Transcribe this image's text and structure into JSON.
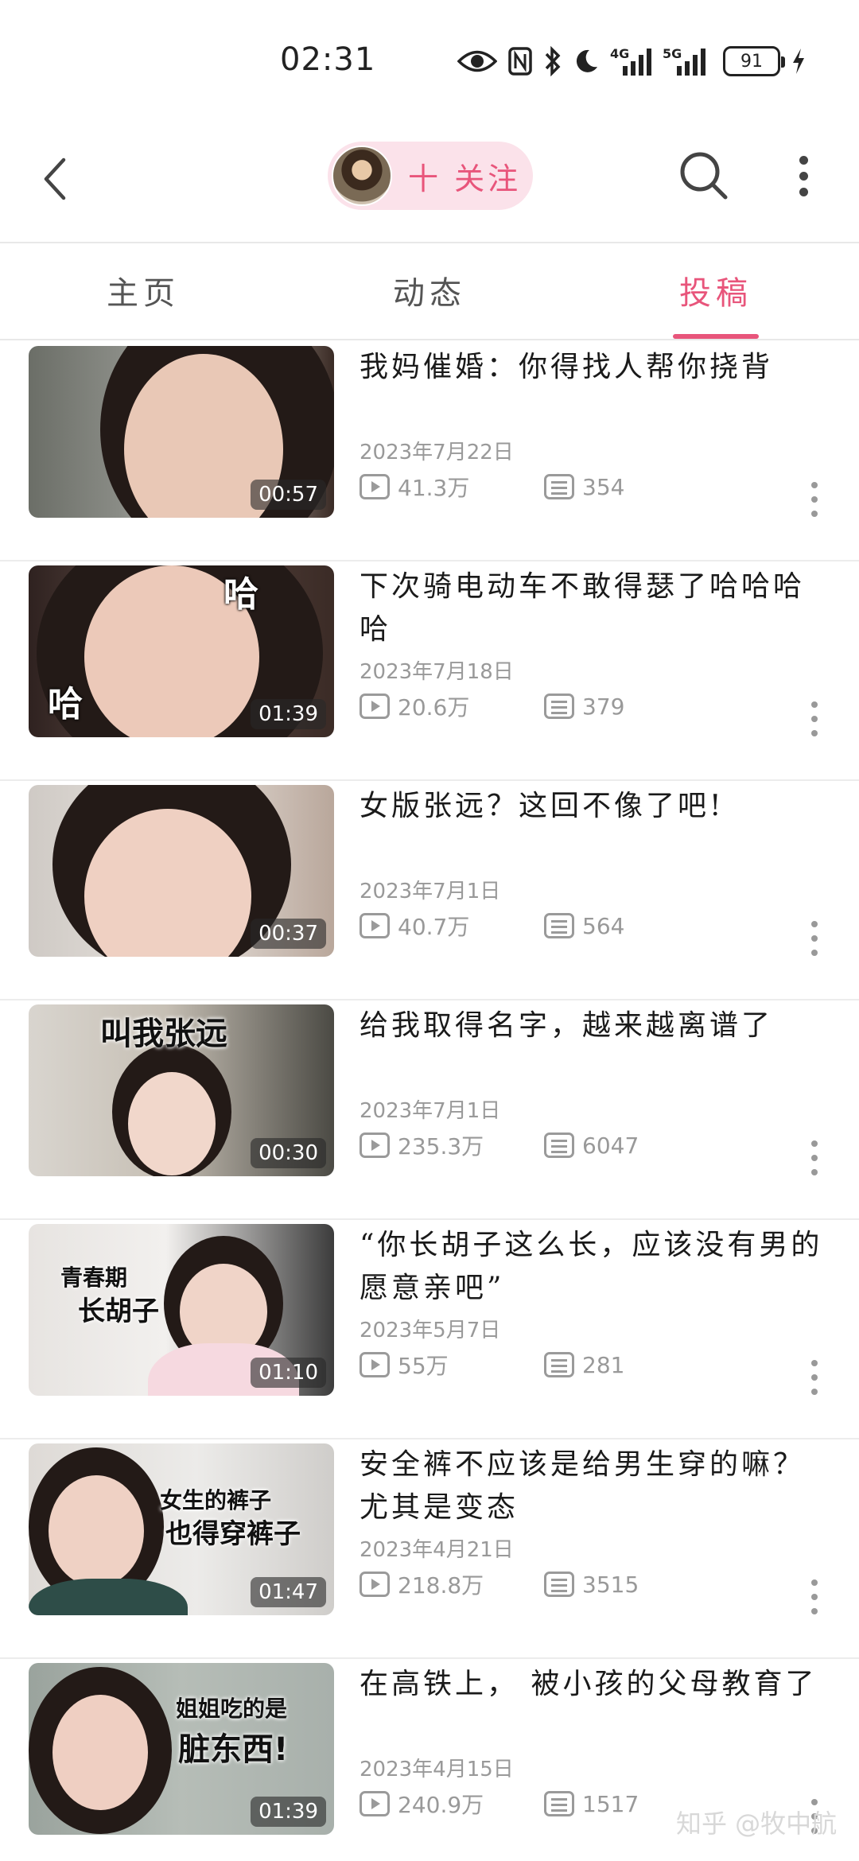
{
  "status_bar": {
    "time": "02:31",
    "net_4g": "4G",
    "net_5g": "5G",
    "battery": "91"
  },
  "header": {
    "follow_label": "十 关注",
    "accent_color": "#e8557b"
  },
  "tabs": [
    {
      "label": "主页",
      "active": false
    },
    {
      "label": "动态",
      "active": false
    },
    {
      "label": "投稿",
      "active": true
    }
  ],
  "videos": [
    {
      "title": "我妈催婚：你得找人帮你挠背",
      "date": "2023年7月22日",
      "views": "41.3万",
      "comments": "354",
      "duration": "00:57"
    },
    {
      "title": "下次骑电动车不敢得瑟了哈哈哈哈",
      "date": "2023年7月18日",
      "views": "20.6万",
      "comments": "379",
      "duration": "01:39",
      "thumb_text": [
        "哈",
        "哈"
      ]
    },
    {
      "title": "女版张远？这回不像了吧!",
      "date": "2023年7月1日",
      "views": "40.7万",
      "comments": "564",
      "duration": "00:37"
    },
    {
      "title": "给我取得名字，越来越离谱了",
      "date": "2023年7月1日",
      "views": "235.3万",
      "comments": "6047",
      "duration": "00:30",
      "thumb_text": [
        "叫我张远"
      ]
    },
    {
      "title": "“你长胡子这么长，应该没有男的愿意亲吧”",
      "date": "2023年5月7日",
      "views": "55万",
      "comments": "281",
      "duration": "01:10",
      "thumb_text": [
        "青春期",
        "长胡子"
      ]
    },
    {
      "title": "安全裤不应该是给男生穿的嘛？尤其是变态",
      "date": "2023年4月21日",
      "views": "218.8万",
      "comments": "3515",
      "duration": "01:47",
      "thumb_text": [
        "女生的裤子",
        "也得穿裤子"
      ]
    },
    {
      "title": "在高铁上， 被小孩的父母教育了",
      "date": "2023年4月15日",
      "views": "240.9万",
      "comments": "1517",
      "duration": "01:39",
      "thumb_text": [
        "姐姐吃的是",
        "脏东西!"
      ]
    }
  ],
  "watermark": "知乎 @牧中航"
}
